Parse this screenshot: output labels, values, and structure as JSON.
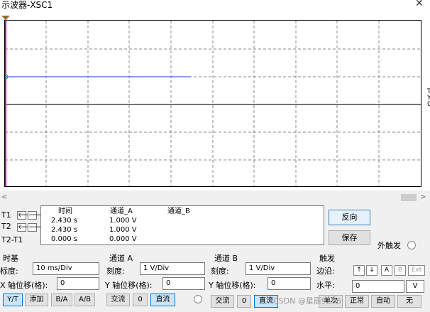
{
  "window": {
    "title": "示波器-XSC1",
    "close_glyph": "✕"
  },
  "screen": {
    "side_marks": [
      "T",
      "Y",
      "0"
    ]
  },
  "scrollbar": {
    "left_glyph": "<",
    "right_glyph": ">"
  },
  "cursors": {
    "t1_label": "T1",
    "t2_label": "T2",
    "t2t1_label": "T2-T1",
    "left_arrow": "🡐",
    "right_arrow": "🡒"
  },
  "readout": {
    "headers": [
      "时间",
      "通道_A",
      "通道_B"
    ],
    "rows": [
      {
        "time": "2.430 s",
        "cha": "1.000 V",
        "chb": ""
      },
      {
        "time": "2.430 s",
        "cha": "1.000 V",
        "chb": ""
      },
      {
        "time": "0.000 s",
        "cha": "0.000 V",
        "chb": ""
      }
    ]
  },
  "actions": {
    "reverse": "反向",
    "save": "保存",
    "ext_trigger": "外触发"
  },
  "timebase": {
    "title": "时基",
    "scale_label": "标度:",
    "scale_value": "10 ms/Div",
    "offset_label": "X 轴位移(格):",
    "offset_value": "0",
    "modes": [
      "Y/T",
      "添加",
      "B/A",
      "A/B"
    ]
  },
  "channel_a": {
    "title": "通道 A",
    "scale_label": "刻度:",
    "scale_value": "1  V/Div",
    "offset_label": "Y 轴位移(格):",
    "offset_value": "0",
    "coupling": [
      "交流",
      "0",
      "直流"
    ]
  },
  "channel_b": {
    "title": "通道 B",
    "scale_label": "刻度:",
    "scale_value": "1  V/Div",
    "offset_label": "Y 轴位移(格):",
    "offset_value": "0",
    "coupling": [
      "交流",
      "0",
      "直流"
    ]
  },
  "trigger": {
    "title": "触发",
    "edge_label": "边沿:",
    "edge_rise": "↑",
    "edge_fall": "↓",
    "sources": [
      "A",
      "B",
      "Ext"
    ],
    "level_label": "水平:",
    "level_value": "0",
    "level_unit": "V",
    "modes": [
      "单次",
      "正常",
      "自动",
      "无"
    ]
  },
  "watermark": "CSDN @星辰9196",
  "colors": {
    "trace_a": "#4169e1",
    "trigger_marker": "#d2691e",
    "left_axis": "#c000c0",
    "selected_border": "#0078d7"
  }
}
